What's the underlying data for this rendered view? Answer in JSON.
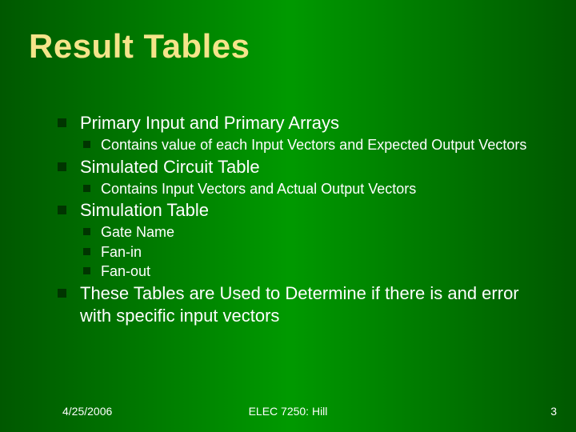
{
  "title": "Result Tables",
  "bullets": {
    "b1": "Primary Input and Primary Arrays",
    "b1_1": "Contains value of each Input Vectors and Expected Output Vectors",
    "b2": "Simulated Circuit Table",
    "b2_1": "Contains Input Vectors and Actual Output Vectors",
    "b3": "Simulation Table",
    "b3_1": "Gate Name",
    "b3_2": "Fan-in",
    "b3_3": "Fan-out",
    "b4": "These Tables are Used to Determine if there is and error with specific input vectors"
  },
  "footer": {
    "date": "4/25/2006",
    "center": "ELEC 7250: Hill",
    "page": "3"
  }
}
